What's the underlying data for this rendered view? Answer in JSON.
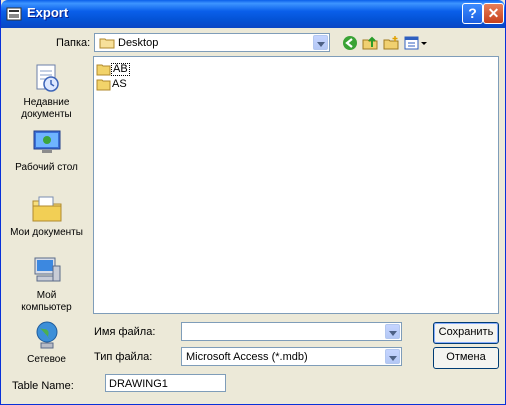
{
  "window": {
    "title": "Export",
    "help_btn": "?",
    "close_btn": "✕"
  },
  "lookin": {
    "label": "Папка:",
    "value": "Desktop"
  },
  "toolbar": {
    "icons": [
      "back-icon",
      "up-folder-icon",
      "new-folder-icon",
      "view-menu-icon"
    ]
  },
  "places": [
    {
      "label": "Недавние\nдокументы",
      "icon": "recent-docs-icon"
    },
    {
      "label": "Рабочий стол",
      "icon": "desktop-icon"
    },
    {
      "label": "Мои документы",
      "icon": "my-documents-icon"
    },
    {
      "label": "Мой\nкомпьютер",
      "icon": "my-computer-icon"
    },
    {
      "label": "Сетевое",
      "icon": "network-icon"
    }
  ],
  "files": [
    {
      "name": "AB",
      "selected": true
    },
    {
      "name": "AS",
      "selected": false
    }
  ],
  "filename": {
    "label": "Имя файла:",
    "value": ""
  },
  "filetype": {
    "label": "Тип файла:",
    "value": "Microsoft Access (*.mdb)"
  },
  "buttons": {
    "save": "Сохранить",
    "cancel": "Отмена"
  },
  "table": {
    "label": "Table Name:",
    "value": "DRAWING1"
  },
  "colors": {
    "titlebar": "#0a5fea",
    "face": "#ece9d8",
    "border": "#7f9db9",
    "folder": "#e8c858"
  }
}
